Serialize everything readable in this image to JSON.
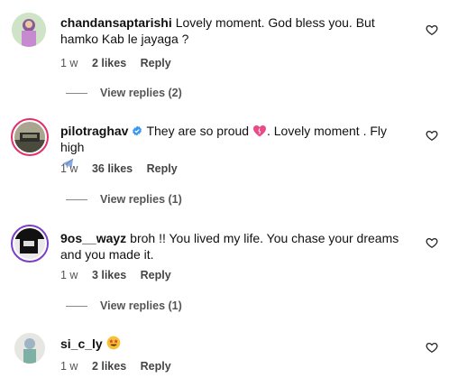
{
  "comments": [
    {
      "username": "chandansaptarishi",
      "text": "Lovely moment. God bless you. But hamko Kab le jayaga ?",
      "age": "1 w",
      "likes": "2 likes",
      "reply": "Reply",
      "view_replies": "View replies (2)"
    },
    {
      "username": "pilotraghav",
      "text": "They are so proud",
      "text2": ". Lovely moment . Fly high",
      "age": "1 w",
      "likes": "36 likes",
      "reply": "Reply",
      "view_replies": "View replies (1)"
    },
    {
      "username": "9os__wayz",
      "text": "broh !! You lived my life. You chase your dreams and you made it.",
      "age": "1 w",
      "likes": "3 likes",
      "reply": "Reply",
      "view_replies": "View replies (1)"
    },
    {
      "username": "si_c_ly",
      "text": "",
      "age": "1 w",
      "likes": "2 likes",
      "reply": "Reply"
    }
  ],
  "icons": {
    "like": "heart-outline-icon",
    "verified": "verified-badge-icon",
    "heart_emoji": "pink-heart-emoji",
    "plane_emoji": "airplane-emoji",
    "star_eyes_emoji": "star-struck-emoji"
  },
  "colors": {
    "ring": "#e1306c",
    "verified": "#3897f0"
  }
}
